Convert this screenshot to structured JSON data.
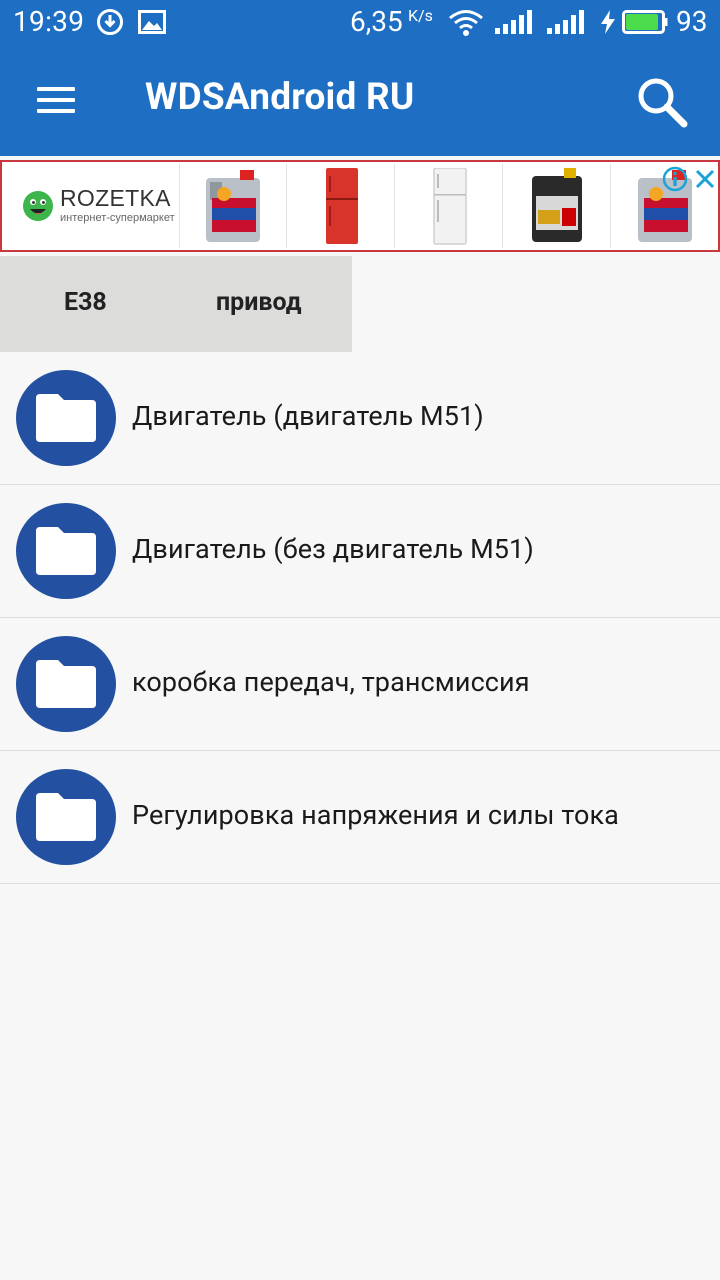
{
  "status_bar": {
    "time": "19:39",
    "speed": "6,35",
    "speed_unit": "K/s",
    "battery_percent": "93",
    "battery_level": 0.93,
    "icons": [
      "download-icon",
      "image-icon",
      "wifi-icon",
      "signal-icon",
      "signal-icon",
      "charging-icon",
      "battery-icon"
    ]
  },
  "app_bar": {
    "title": "WDSAndroid RU",
    "menu_icon": "menu-icon",
    "search_icon": "search-icon"
  },
  "ad_banner": {
    "brand": "ROZETKA",
    "tagline": "интернет-супермаркет",
    "products": [
      "motor-oil",
      "red-refrigerator",
      "white-refrigerator",
      "motor-oil",
      "motor-oil"
    ],
    "info_icon": "info-icon",
    "close_icon": "close-icon",
    "border_color": "#c9383f"
  },
  "breadcrumb": [
    "E38",
    "привод"
  ],
  "folders": [
    {
      "label": "Двигатель (двигатель М51)",
      "icon": "folder-icon"
    },
    {
      "label": "Двигатель (без двигатель М51)",
      "icon": "folder-icon"
    },
    {
      "label": "коробка передач, трансмиссия",
      "icon": "folder-icon"
    },
    {
      "label": "Регулировка напряжения и силы тока",
      "icon": "folder-icon"
    }
  ],
  "colors": {
    "primary": "#1e6fc4",
    "folder_circle": "#2350a0",
    "background": "#f7f7f7",
    "breadcrumb_bg": "#dcdcda"
  }
}
